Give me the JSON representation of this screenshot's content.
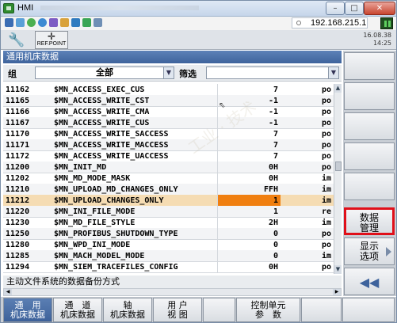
{
  "window": {
    "title": "HMI"
  },
  "toolbar": {
    "ip_address": "192.168.215.1",
    "status_line1": "16.08.38",
    "status_line2": "14:25",
    "refpoint_label": "REF.POINT"
  },
  "panel": {
    "title": "通用机床数据",
    "group_label": "组",
    "group_value": "全部",
    "filter_label": "筛选",
    "filter_value": "",
    "footer_text": "主动文件系统的数据备份方式"
  },
  "rows": [
    {
      "num": "11162",
      "name": "$MN_ACCESS_EXEC_CUS",
      "value": "7",
      "unit": "po"
    },
    {
      "num": "11165",
      "name": "$MN_ACCESS_WRITE_CST",
      "value": "-1",
      "unit": "po"
    },
    {
      "num": "11166",
      "name": "$MN_ACCESS_WRITE_CMA",
      "value": "-1",
      "unit": "po"
    },
    {
      "num": "11167",
      "name": "$MN_ACCESS_WRITE_CUS",
      "value": "-1",
      "unit": "po"
    },
    {
      "num": "11170",
      "name": "$MN_ACCESS_WRITE_SACCESS",
      "value": "7",
      "unit": "po"
    },
    {
      "num": "11171",
      "name": "$MN_ACCESS_WRITE_MACCESS",
      "value": "7",
      "unit": "po"
    },
    {
      "num": "11172",
      "name": "$MN_ACCESS_WRITE_UACCESS",
      "value": "7",
      "unit": "po"
    },
    {
      "num": "11200",
      "name": "$MN_INIT_MD",
      "value": "0H",
      "unit": "po"
    },
    {
      "num": "11202",
      "name": "$MN_MD_MODE_MASK",
      "value": "0H",
      "unit": "im"
    },
    {
      "num": "11210",
      "name": "$MN_UPLOAD_MD_CHANGES_ONLY",
      "value": "FFH",
      "unit": "im"
    },
    {
      "num": "11212",
      "name": "$MN_UPLOAD_CHANGES_ONLY",
      "value": "1",
      "unit": "im"
    },
    {
      "num": "11220",
      "name": "$MN_INI_FILE_MODE",
      "value": "1",
      "unit": "re"
    },
    {
      "num": "11230",
      "name": "$MN_MD_FILE_STYLE",
      "value": "2H",
      "unit": "im"
    },
    {
      "num": "11250",
      "name": "$MN_PROFIBUS_SHUTDOWN_TYPE",
      "value": "0",
      "unit": "po"
    },
    {
      "num": "11280",
      "name": "$MN_WPD_INI_MODE",
      "value": "0",
      "unit": "po"
    },
    {
      "num": "11285",
      "name": "$MN_MACH_MODEL_MODE",
      "value": "0",
      "unit": "im"
    },
    {
      "num": "11294",
      "name": "$MN_SIEM_TRACEFILES_CONFIG",
      "value": "0H",
      "unit": "po"
    }
  ],
  "selected_row_index": 10,
  "softkeys_right": [
    {
      "label": ""
    },
    {
      "label": ""
    },
    {
      "label": ""
    },
    {
      "label": ""
    },
    {
      "label": ""
    },
    {
      "label": ""
    },
    {
      "label": "数据\n管理"
    },
    {
      "label": "显示\n选项"
    },
    {
      "label": "◀◀"
    }
  ],
  "softkeys_bottom": [
    {
      "label": "通　用\n机床数据",
      "active": true
    },
    {
      "label": "通　道\n机床数据",
      "active": false
    },
    {
      "label": "轴\n机床数据",
      "active": false
    },
    {
      "label": "用 户\n视 图",
      "active": false
    },
    {
      "label": "",
      "active": false
    },
    {
      "label": "控制单元\n参　数",
      "active": false
    },
    {
      "label": "",
      "active": false
    },
    {
      "label": "",
      "active": false
    }
  ],
  "colors": {
    "title_bar": "#3e639c",
    "selected_row": "#f5dcb3",
    "selected_value": "#f07f10",
    "highlight_box": "#e0101a"
  }
}
